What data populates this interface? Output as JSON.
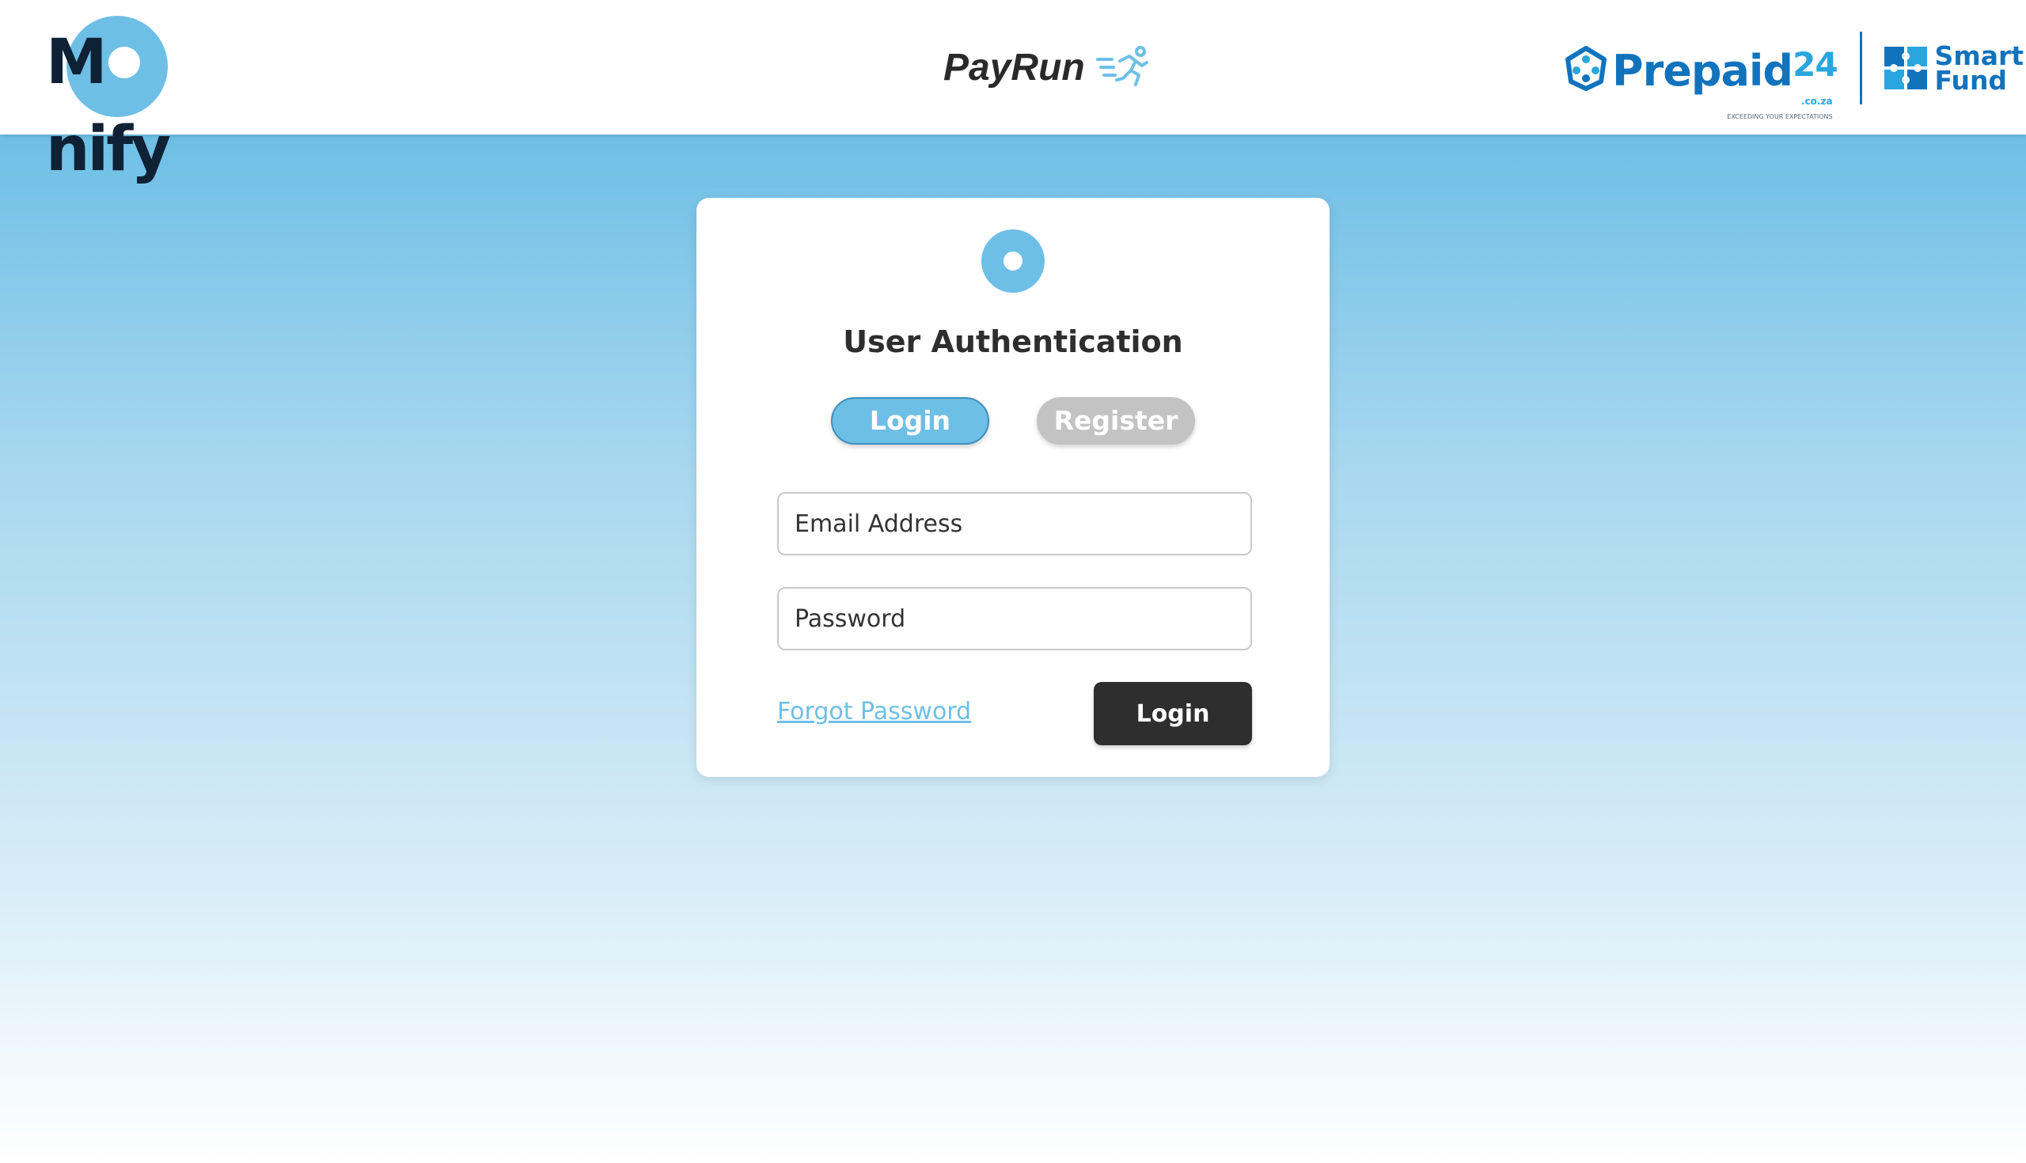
{
  "header": {
    "brand": {
      "part1": "M",
      "part2": "nify"
    },
    "product_name": "PayRun",
    "partners": {
      "prepaid": {
        "name": "Prepaid",
        "number": "24",
        "tld": ".co.za",
        "tagline": "EXCEEDING YOUR EXPECTATIONS",
        "color": "#1273bd"
      },
      "smartfund": {
        "line1": "Smart",
        "line2": "Fund",
        "color": "#1273bd"
      }
    }
  },
  "auth": {
    "title": "User Authentication",
    "tabs": {
      "login": "Login",
      "register": "Register",
      "active": "login"
    },
    "email": {
      "placeholder": "Email Address",
      "value": ""
    },
    "password": {
      "placeholder": "Password",
      "value": ""
    },
    "forgot_link": "Forgot Password",
    "submit_label": "Login"
  },
  "colors": {
    "accent": "#6ebfe6",
    "dark_button": "#2e2e2e",
    "inactive_tab": "#c3c3c3",
    "brand_dark": "#0f2135"
  },
  "icons": {
    "card_icon": "circle-dot-icon",
    "product_icon": "runner-icon",
    "prepaid_icon": "prepaid-badge-icon",
    "smartfund_icon": "puzzle-icon"
  }
}
